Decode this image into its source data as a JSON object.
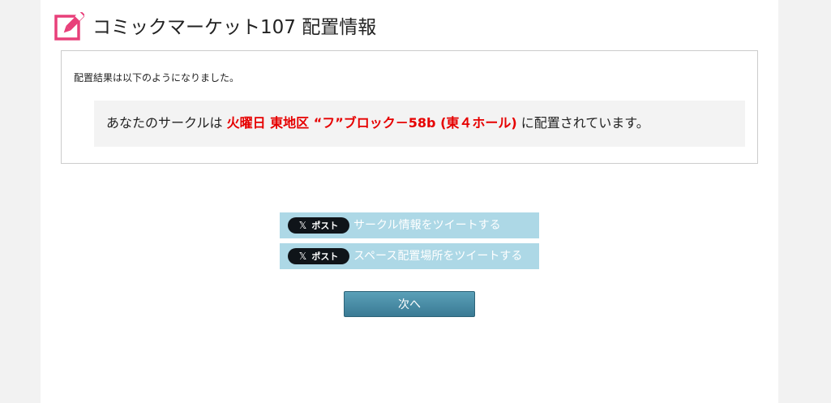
{
  "header": {
    "title": "コミックマーケット107 配置情報",
    "icon": "edit-icon",
    "icon_color": "#e8407a"
  },
  "result": {
    "intro": "配置結果は以下のようになりました。",
    "prefix": "あなたのサークルは ",
    "location": "火曜日 東地区 “フ”ブロック－58b (東４ホール)",
    "suffix": " に配置されています。",
    "highlight_color": "#e60000"
  },
  "share": {
    "x_icon": "x-logo-icon",
    "post_label": "ポスト",
    "tweet_circle_label": "サークル情報をツイートする",
    "tweet_space_label": "スペース配置場所をツイートする",
    "button_color": "#add8e6"
  },
  "actions": {
    "next_label": "次へ"
  }
}
